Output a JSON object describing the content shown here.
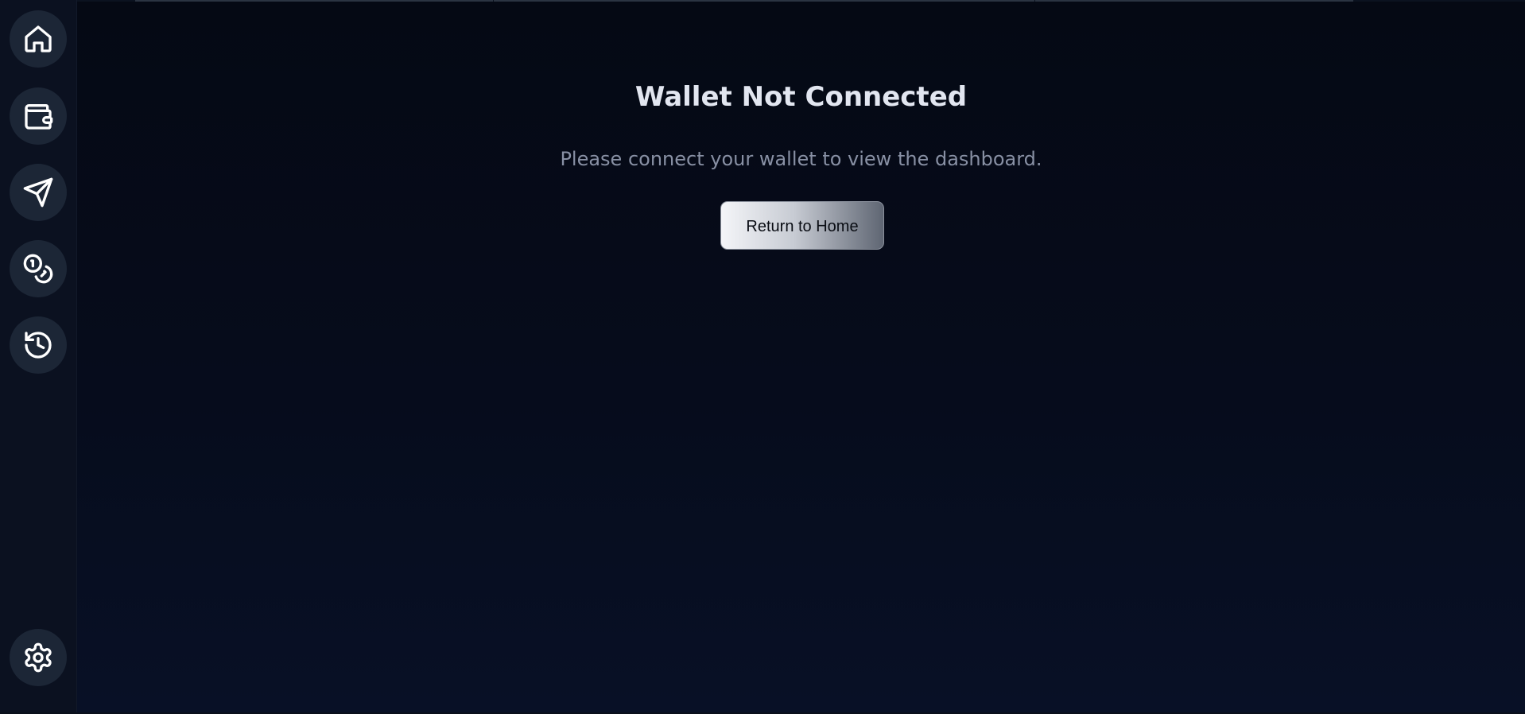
{
  "sidebar": {
    "items": [
      {
        "icon": "home-icon",
        "label": "Home"
      },
      {
        "icon": "wallet-icon",
        "label": "Wallet"
      },
      {
        "icon": "send-icon",
        "label": "Send"
      },
      {
        "icon": "coins-icon",
        "label": "Tokens"
      },
      {
        "icon": "history-icon",
        "label": "History"
      }
    ],
    "footer_icon": "settings-icon"
  },
  "main": {
    "title": "Wallet Not Connected",
    "message": "Please connect your wallet to view the dashboard.",
    "return_button_label": "Return to Home"
  },
  "colors": {
    "background": "#050914",
    "sidebar": "#0b1120",
    "nav_button": "#1c2636",
    "title": "#e2e6f0",
    "message": "#8890a4"
  }
}
